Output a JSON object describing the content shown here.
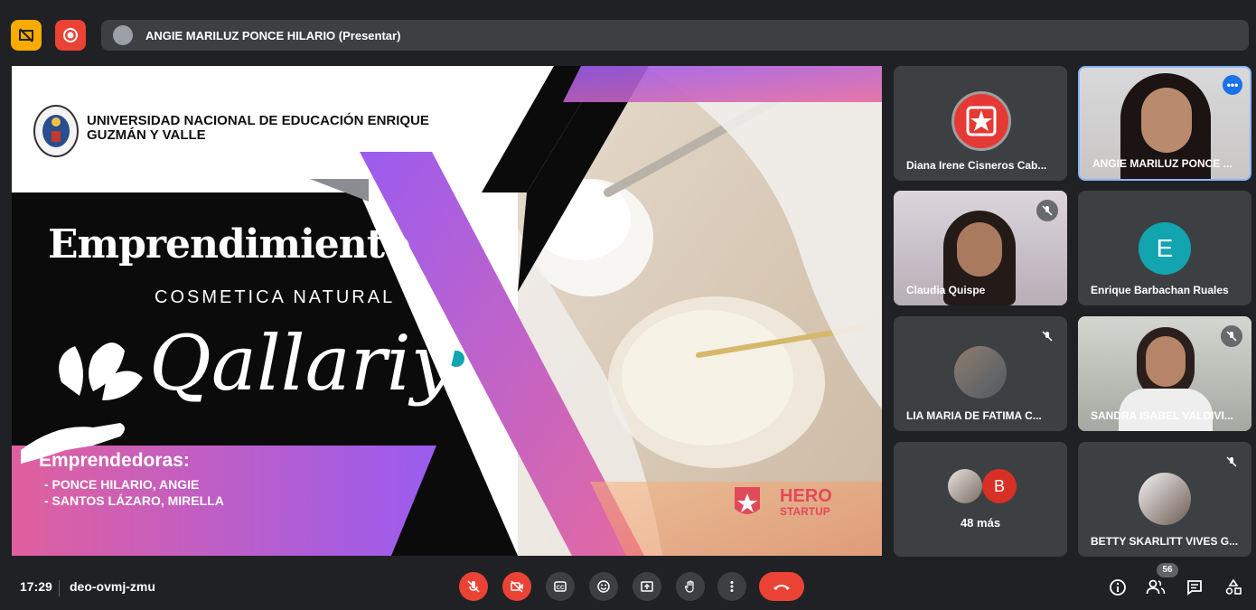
{
  "topbar": {
    "presenter_label": "ANGIE MARILUZ PONCE HILARIO (Presentar)"
  },
  "slide": {
    "university_line1": "UNIVERSIDAD NACIONAL DE EDUCACIÓN ENRIQUE",
    "university_line2": "GUZMÁN Y VALLE",
    "title": "Emprendimiento",
    "subtitle": "COSMETICA NATURAL",
    "brand": "Qallariy",
    "entrepreneurs_heading": "Emprendedoras:",
    "entrepreneur_1": "- PONCE HILARIO, ANGIE",
    "entrepreneur_2": "- SANTOS LÁZARO, MIRELLA",
    "hero_line1": "HERO",
    "hero_line2": "STARTUP"
  },
  "participants": [
    {
      "name": "Diana Irene Cisneros Cab...",
      "initial": ""
    },
    {
      "name": "ANGIE MARILUZ PONCE ...",
      "initial": ""
    },
    {
      "name": "Claudia Quispe",
      "initial": ""
    },
    {
      "name": "Enrique Barbachan Ruales",
      "initial": "E"
    },
    {
      "name": "LIA MARIA DE FATIMA C...",
      "initial": ""
    },
    {
      "name": "SANDRA ISABEL VALDIVI...",
      "initial": ""
    },
    {
      "name": "48 más",
      "initial": "B"
    },
    {
      "name": "BETTY SKARLITT VIVES G...",
      "initial": ""
    }
  ],
  "bottombar": {
    "time": "17:29",
    "meeting_code": "deo-ovmj-zmu",
    "participant_count": "56"
  },
  "colors": {
    "accent_red": "#ea4335",
    "accent_yellow": "#f9ab00",
    "teal_avatar": "#12a4af",
    "purple": "#8e5bf2",
    "pink": "#e0609e"
  }
}
